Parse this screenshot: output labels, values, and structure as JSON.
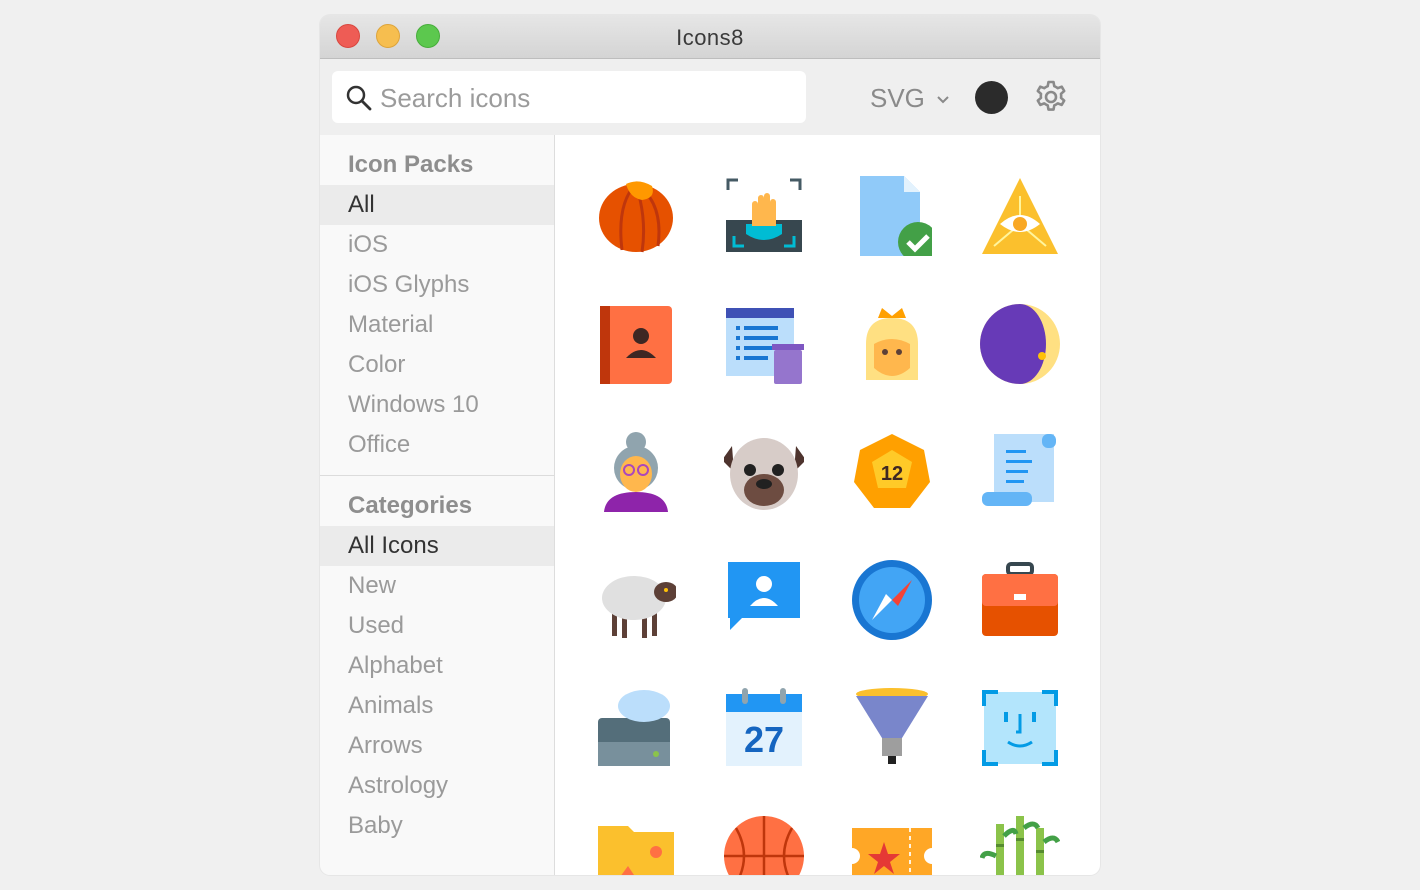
{
  "window": {
    "title": "Icons8"
  },
  "toolbar": {
    "search_placeholder": "Search icons",
    "format_label": "SVG",
    "color_swatch": "#2b2b2b"
  },
  "sidebar": {
    "packs_title": "Icon Packs",
    "packs": [
      "All",
      "iOS",
      "iOS Glyphs",
      "Material",
      "Color",
      "Windows 10",
      "Office"
    ],
    "packs_active": "All",
    "categories_title": "Categories",
    "categories": [
      "All Icons",
      "New",
      "Used",
      "Alphabet",
      "Animals",
      "Arrows",
      "Astrology",
      "Baby"
    ],
    "categories_active": "All Icons"
  },
  "icons": [
    "hazelnut-icon",
    "palm-scanner-icon",
    "approved-document-icon",
    "eye-of-providence-icon",
    "address-book-icon",
    "delete-list-icon",
    "queen-icon",
    "moon-phase-icon",
    "grandmother-icon",
    "pug-icon",
    "d12-dice-icon",
    "scroll-icon",
    "sheep-icon",
    "contact-message-icon",
    "safari-icon",
    "briefcase-icon",
    "cloud-storage-icon",
    "calendar-27-icon",
    "floodlight-icon",
    "face-id-icon",
    "image-folder-icon",
    "basketball-icon",
    "ticket-icon",
    "bamboo-icon"
  ],
  "icon_text": {
    "dice_number": "12",
    "calendar_day": "27"
  },
  "colors": {
    "accent_orange": "#f4511e",
    "accent_blue": "#2196f3",
    "accent_yellow": "#fbc02d"
  }
}
